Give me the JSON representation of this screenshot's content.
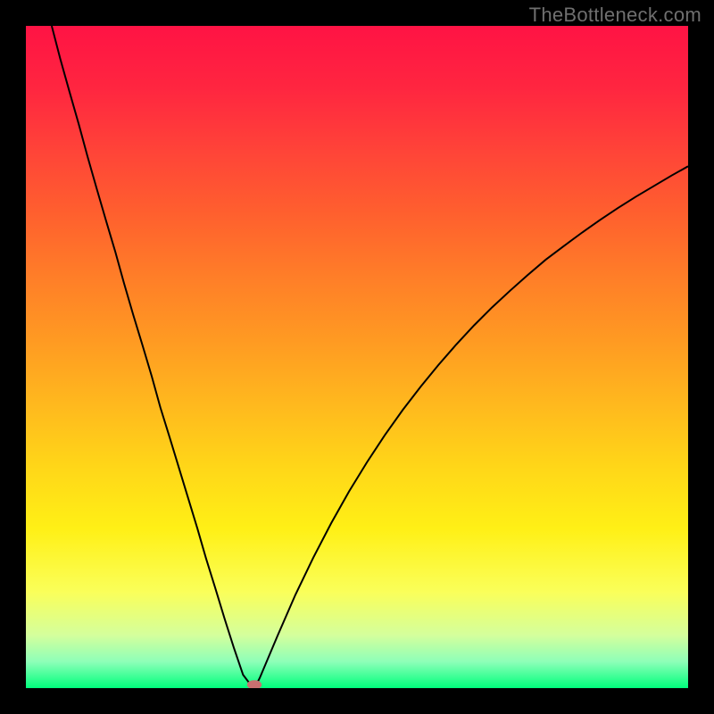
{
  "watermark": "TheBottleneck.com",
  "chart_data": {
    "type": "line",
    "title": "",
    "xlabel": "",
    "ylabel": "",
    "xlim": [
      0,
      100
    ],
    "ylim": [
      0,
      100
    ],
    "legend": false,
    "grid": false,
    "background_gradient": {
      "stops": [
        {
          "offset": 0.0,
          "color": "#ff1344"
        },
        {
          "offset": 0.095,
          "color": "#ff2640"
        },
        {
          "offset": 0.19,
          "color": "#ff4438"
        },
        {
          "offset": 0.285,
          "color": "#ff602e"
        },
        {
          "offset": 0.38,
          "color": "#ff7e28"
        },
        {
          "offset": 0.475,
          "color": "#ff9a22"
        },
        {
          "offset": 0.57,
          "color": "#ffb81e"
        },
        {
          "offset": 0.665,
          "color": "#ffd618"
        },
        {
          "offset": 0.76,
          "color": "#fff016"
        },
        {
          "offset": 0.855,
          "color": "#faff5a"
        },
        {
          "offset": 0.92,
          "color": "#d4ff9c"
        },
        {
          "offset": 0.96,
          "color": "#8effb8"
        },
        {
          "offset": 1.0,
          "color": "#00ff7c"
        }
      ]
    },
    "series": [
      {
        "name": "bottleneck-curve",
        "color": "#000000",
        "x": [
          3.9,
          5.2,
          6.6,
          8.0,
          9.3,
          10.7,
          12.1,
          13.5,
          14.8,
          16.2,
          17.6,
          19.0,
          20.3,
          21.7,
          23.1,
          24.5,
          25.9,
          27.2,
          28.6,
          30.0,
          31.4,
          32.8,
          34.1,
          34.6,
          34.6,
          35.3,
          38.0,
          40.7,
          43.4,
          46.1,
          48.8,
          51.5,
          54.2,
          56.9,
          59.6,
          62.3,
          65.0,
          67.7,
          70.4,
          73.1,
          75.8,
          78.5,
          81.3,
          84.0,
          86.7,
          89.4,
          92.1,
          94.8,
          97.5,
          100.0
        ],
        "y": [
          100.0,
          95.0,
          90.0,
          85.1,
          80.3,
          75.4,
          70.6,
          65.9,
          61.2,
          56.4,
          51.8,
          47.1,
          42.4,
          37.9,
          33.3,
          28.7,
          24.1,
          19.6,
          15.1,
          10.5,
          6.1,
          2.0,
          0.3,
          0.5,
          0.2,
          1.5,
          7.9,
          14.1,
          19.7,
          24.9,
          29.7,
          34.1,
          38.2,
          42.0,
          45.5,
          48.8,
          51.9,
          54.8,
          57.5,
          60.0,
          62.4,
          64.7,
          66.8,
          68.8,
          70.7,
          72.5,
          74.2,
          75.8,
          77.4,
          78.8
        ]
      }
    ],
    "marker": {
      "name": "minimum-point",
      "x": 34.5,
      "y": 0.5,
      "rx": 1.1,
      "ry": 0.7,
      "color": "#c97070"
    }
  }
}
